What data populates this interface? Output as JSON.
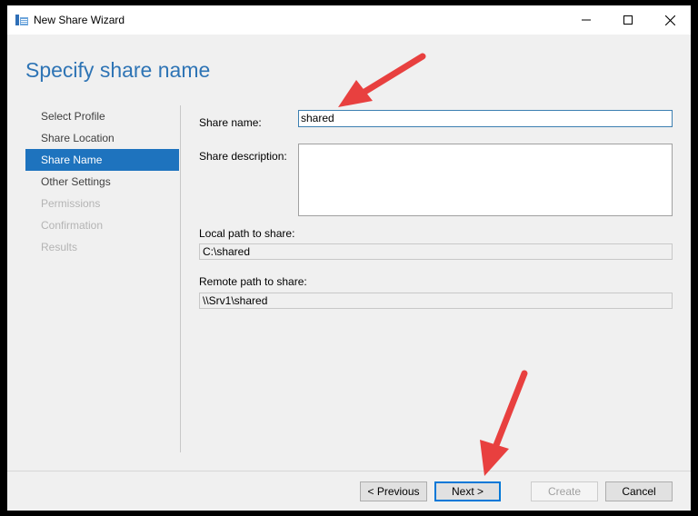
{
  "window": {
    "title": "New Share Wizard",
    "page_title": "Specify share name"
  },
  "nav": {
    "items": [
      {
        "label": "Select Profile",
        "state": "completed"
      },
      {
        "label": "Share Location",
        "state": "completed"
      },
      {
        "label": "Share Name",
        "state": "selected"
      },
      {
        "label": "Other Settings",
        "state": "enabled"
      },
      {
        "label": "Permissions",
        "state": "disabled"
      },
      {
        "label": "Confirmation",
        "state": "disabled"
      },
      {
        "label": "Results",
        "state": "disabled"
      }
    ]
  },
  "form": {
    "share_name_label": "Share name:",
    "share_name_value": "shared",
    "share_description_label": "Share description:",
    "share_description_value": "",
    "local_path_label": "Local path to share:",
    "local_path_value": "C:\\shared",
    "remote_path_label": "Remote path to share:",
    "remote_path_value": "\\\\Srv1\\shared"
  },
  "footer": {
    "previous_label": "< Previous",
    "next_label": "Next >",
    "create_label": "Create",
    "cancel_label": "Cancel"
  },
  "annotations": {
    "arrow_color": "#e8403f"
  },
  "colors": {
    "accent": "#1e73be",
    "title_blue": "#2e74b5"
  }
}
